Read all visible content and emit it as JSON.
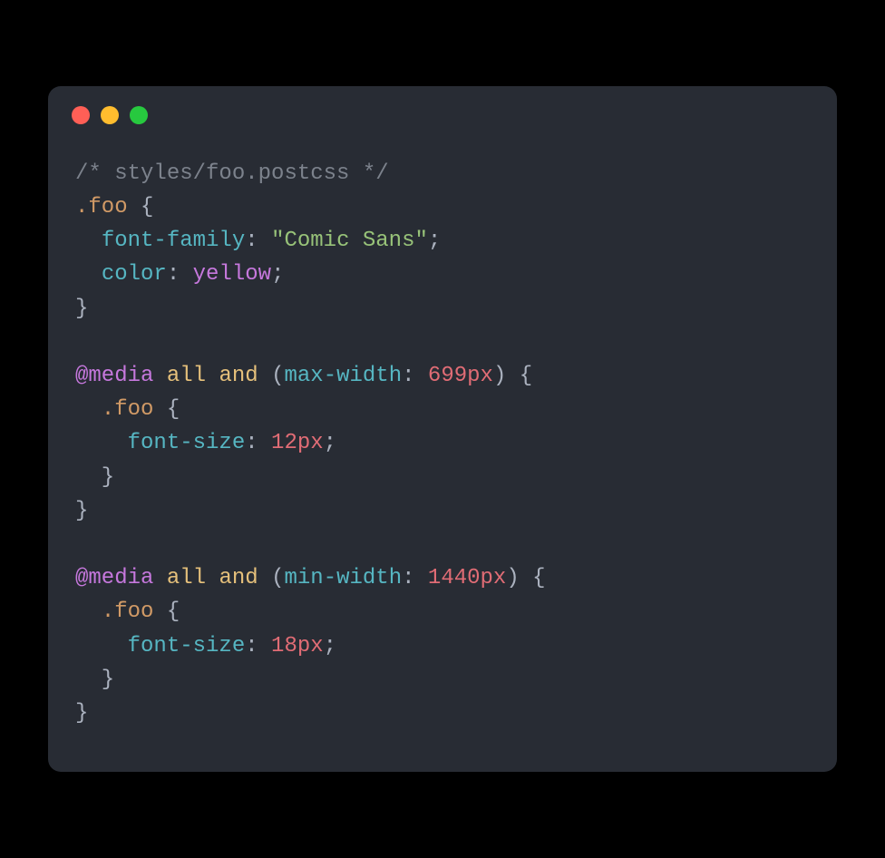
{
  "window": {
    "buttons": [
      "close",
      "minimize",
      "zoom"
    ]
  },
  "colors": {
    "background": "#282c34",
    "comment": "#7c828c",
    "selector": "#d19a66",
    "punct": "#abb2bf",
    "property": "#56b6c2",
    "string": "#98c379",
    "value": "#c678dd",
    "atrule": "#c678dd",
    "keyword": "#e5c07b",
    "number": "#e06c75"
  },
  "code": {
    "language": "postcss",
    "tokens": [
      [
        [
          "comment",
          "/* styles/foo.postcss */"
        ]
      ],
      [
        [
          "selector",
          ".foo"
        ],
        [
          "punct",
          " {"
        ]
      ],
      [
        [
          "punct",
          "  "
        ],
        [
          "prop",
          "font-family"
        ],
        [
          "punct",
          ": "
        ],
        [
          "string",
          "\"Comic Sans\""
        ],
        [
          "punct",
          ";"
        ]
      ],
      [
        [
          "punct",
          "  "
        ],
        [
          "prop",
          "color"
        ],
        [
          "punct",
          ": "
        ],
        [
          "value",
          "yellow"
        ],
        [
          "punct",
          ";"
        ]
      ],
      [
        [
          "punct",
          "}"
        ]
      ],
      [],
      [
        [
          "at",
          "@media"
        ],
        [
          "punct",
          " "
        ],
        [
          "kw",
          "all"
        ],
        [
          "punct",
          " "
        ],
        [
          "kw",
          "and"
        ],
        [
          "punct",
          " ("
        ],
        [
          "prop",
          "max-width"
        ],
        [
          "punct",
          ": "
        ],
        [
          "number",
          "699px"
        ],
        [
          "punct",
          ") {"
        ]
      ],
      [
        [
          "punct",
          "  "
        ],
        [
          "selector",
          ".foo"
        ],
        [
          "punct",
          " {"
        ]
      ],
      [
        [
          "punct",
          "    "
        ],
        [
          "prop",
          "font-size"
        ],
        [
          "punct",
          ": "
        ],
        [
          "number",
          "12px"
        ],
        [
          "punct",
          ";"
        ]
      ],
      [
        [
          "punct",
          "  }"
        ]
      ],
      [
        [
          "punct",
          "}"
        ]
      ],
      [],
      [
        [
          "at",
          "@media"
        ],
        [
          "punct",
          " "
        ],
        [
          "kw",
          "all"
        ],
        [
          "punct",
          " "
        ],
        [
          "kw",
          "and"
        ],
        [
          "punct",
          " ("
        ],
        [
          "prop",
          "min-width"
        ],
        [
          "punct",
          ": "
        ],
        [
          "number",
          "1440px"
        ],
        [
          "punct",
          ") {"
        ]
      ],
      [
        [
          "punct",
          "  "
        ],
        [
          "selector",
          ".foo"
        ],
        [
          "punct",
          " {"
        ]
      ],
      [
        [
          "punct",
          "    "
        ],
        [
          "prop",
          "font-size"
        ],
        [
          "punct",
          ": "
        ],
        [
          "number",
          "18px"
        ],
        [
          "punct",
          ";"
        ]
      ],
      [
        [
          "punct",
          "  }"
        ]
      ],
      [
        [
          "punct",
          "}"
        ]
      ]
    ]
  }
}
